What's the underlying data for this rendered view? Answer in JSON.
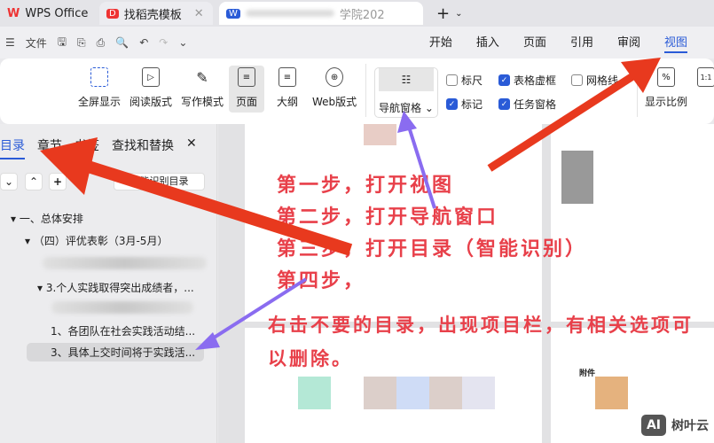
{
  "tabs": [
    {
      "label": "WPS Office"
    },
    {
      "label": "找稻壳模板"
    },
    {
      "label": "学院202"
    }
  ],
  "menu": {
    "file": "文件",
    "tabs": [
      "开始",
      "插入",
      "页面",
      "引用",
      "审阅",
      "视图"
    ]
  },
  "ribbon": {
    "buttons": [
      "全屏显示",
      "阅读版式",
      "写作模式",
      "页面",
      "大纲",
      "Web版式"
    ],
    "nav_pane": "导航窗格",
    "checks": [
      {
        "label": "标尺",
        "checked": false
      },
      {
        "label": "表格虚框",
        "checked": true
      },
      {
        "label": "网格线",
        "checked": false
      },
      {
        "label": "标记",
        "checked": true
      },
      {
        "label": "任务窗格",
        "checked": true
      }
    ],
    "zoom": "显示比例"
  },
  "panel": {
    "tabs": [
      "目录",
      "章节",
      "书签",
      "查找和替换"
    ],
    "smart_toc": "智能识别目录",
    "items": [
      "一、总体安排",
      "（四）评优表彰（3月-5月）",
      "3.个人实践取得突出成绩者，...",
      "1、各团队在社会实践活动结...",
      "3、具体上交时间将于实践活..."
    ]
  },
  "annotation": {
    "steps": [
      "第一步，打开视图",
      "第二步，打开导航窗口",
      "第三步，打开目录（智能识别）",
      "第四步，"
    ],
    "note": "右击不要的目录，出现项目栏，有相关选项可以删除。"
  },
  "doc": {
    "attachment": "附件"
  },
  "watermark": {
    "ai": "AI",
    "brand": "树叶云"
  },
  "colors": {
    "accent": "#2a5bd7",
    "arrow_red": "#e8391e",
    "arrow_purple": "#8a6cf0",
    "annotation": "#e8404a"
  }
}
